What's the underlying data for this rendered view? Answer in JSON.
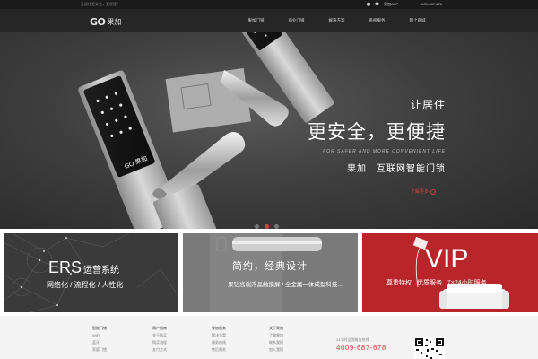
{
  "topbar": {
    "welcome": "让居住更安全，更便捷！",
    "app_label": "果加APP",
    "phone": "4009-687-678"
  },
  "nav": {
    "brand_mark": "GO",
    "brand_name": "果加",
    "items": [
      {
        "label": "果加门锁"
      },
      {
        "label": "商业门锁"
      },
      {
        "label": "解决方案"
      },
      {
        "label": "系统服务"
      },
      {
        "label": "网上商城"
      }
    ]
  },
  "hero": {
    "kicker": "让居住",
    "title": "更安全，更便捷",
    "subtitle_en": "FOR SAFER AND MORE CONVENIENT LIFE",
    "subtitle": "果加　互联网智能门锁",
    "more_label": "了解更多",
    "more_arrow": "›",
    "lock_brand": "GO 果加",
    "slides": 3,
    "active_slide": 1
  },
  "promos": {
    "ers": {
      "title": "ERS",
      "title_cn": "运营系统",
      "subtitle": "网络化 / 流程化 / 人性化"
    },
    "simple": {
      "title": "简约，经典设计",
      "subtitle": "果钻高端浮晶触摸屏 / 全金属一体成型科技..."
    },
    "vip": {
      "title": "VIP",
      "subtitle": "尊贵特权 优质服务 7×24小时服务"
    }
  },
  "footer": {
    "columns": [
      {
        "head": "智能门锁",
        "links": [
          "WiFi",
          "蓝牙",
          "家庭门锁"
        ]
      },
      {
        "head": "用户指南",
        "links": [
          "关于购买",
          "购买流程",
          "支付方式"
        ]
      },
      {
        "head": "果加服务",
        "links": [
          "解决方案",
          "服务热线",
          "售后服务"
        ]
      },
      {
        "head": "关于果加",
        "links": [
          "了解果加",
          "联系我们",
          "加入我们"
        ]
      }
    ],
    "hotline_label": "24小时全国服务热线",
    "hotline_number": "4009-687-678"
  },
  "colors": {
    "accent": "#d9413a",
    "nav_bg": "#262626",
    "topbar_bg": "#1a1a1a",
    "vip_bg": "#b8262c"
  }
}
